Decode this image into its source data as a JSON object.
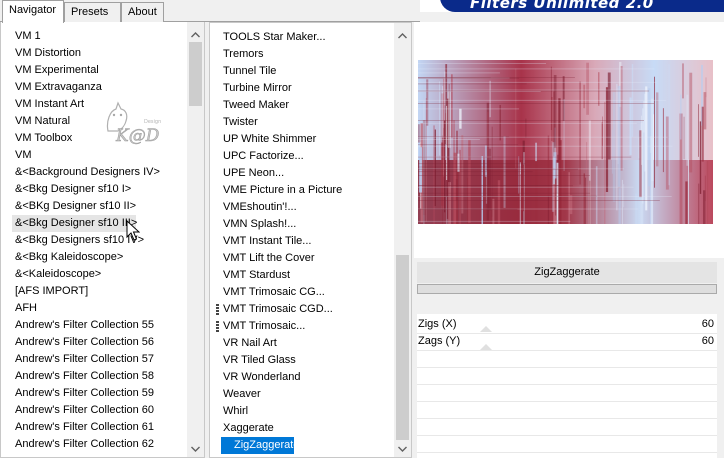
{
  "app": {
    "title": "Filters Unlimited 2.0"
  },
  "tabs": [
    {
      "label": "Navigator",
      "active": true
    },
    {
      "label": "Presets",
      "active": false
    },
    {
      "label": "About",
      "active": false
    }
  ],
  "categories": {
    "items": [
      "VM 1",
      "VM Distortion",
      "VM Experimental",
      "VM Extravaganza",
      "VM Instant Art",
      "VM Natural",
      "VM Toolbox",
      "VM",
      "&<Background Designers IV>",
      "&<Bkg Designer sf10 I>",
      "&<BKg Designer sf10 II>",
      "&<Bkg Designer sf10 III>",
      "&<Bkg Designers sf10 IV>",
      "&<Bkg Kaleidoscope>",
      "&<Kaleidoscope>",
      "[AFS IMPORT]",
      "AFH",
      "Andrew's Filter Collection 55",
      "Andrew's Filter Collection 56",
      "Andrew's Filter Collection 57",
      "Andrew's Filter Collection 58",
      "Andrew's Filter Collection 59",
      "Andrew's Filter Collection 60",
      "Andrew's Filter Collection 61",
      "Andrew's Filter Collection 62"
    ],
    "hovered": "&<Bkg Designer sf10 III>"
  },
  "filters": {
    "items": [
      "TOOLS Star Maker...",
      "Tremors",
      "Tunnel Tile",
      "Turbine Mirror",
      "Tweed Maker",
      "Twister",
      "UP White Shimmer",
      "UPC Factorize...",
      "UPE Neon...",
      "VME Picture in a Picture",
      "VMEshoutin'!...",
      "VMN Splash!...",
      "VMT Instant Tile...",
      "VMT Lift the Cover",
      "VMT Stardust",
      "VMT Trimosaic CG...",
      "VMT Trimosaic CGD...",
      "VMT Trimosaic...",
      "VR Nail Art",
      "VR Tiled Glass",
      "VR Wonderland",
      "Weaver",
      "Whirl",
      "Xaggerate",
      "ZigZaggerate"
    ],
    "selected": "ZigZaggerate",
    "grip_items": [
      "VMT Trimosaic CGD...",
      "VMT Trimosaic..."
    ]
  },
  "selected_filter": {
    "name": "ZigZaggerate"
  },
  "parameters": [
    {
      "name": "Zigs (X)",
      "value": "60"
    },
    {
      "name": "Zags (Y)",
      "value": "60"
    }
  ],
  "watermark": {
    "text": "K@D"
  },
  "colors": {
    "selection": "#0078d7",
    "banner": "#0a2a8a",
    "preview_red": "#9a2a3c",
    "preview_blue": "#b9d0f0"
  },
  "icons": {
    "scroll_up": "chevron-up-icon",
    "scroll_down": "chevron-down-icon",
    "cursor": "mouse-pointer-icon"
  }
}
